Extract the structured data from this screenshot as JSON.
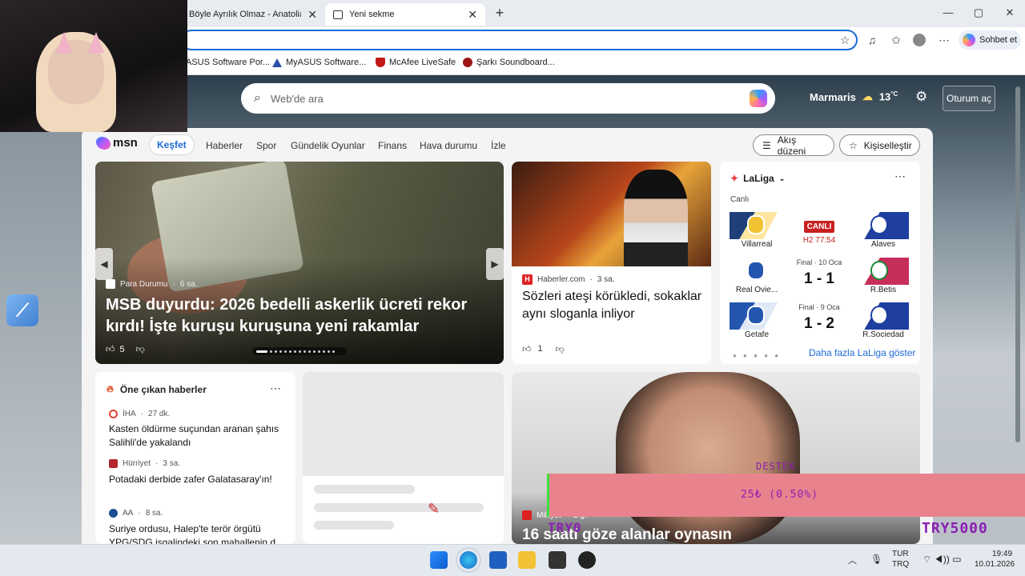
{
  "browser": {
    "tabs": [
      {
        "title": "Böyle Ayrılık Olmaz - Anatolian Psy",
        "active": false
      },
      {
        "title": "Yeni sekme",
        "active": true
      }
    ],
    "new_tab": "+",
    "window_controls": {
      "minimize": "—",
      "maximize": "▢",
      "close": "✕"
    },
    "address": "",
    "copilot_label": "Sohbet et",
    "bookmarks": [
      "ASUS Software Por...",
      "MyASUS Software...",
      "McAfee LiveSafe",
      "Şarkı Soundboard..."
    ]
  },
  "search": {
    "placeholder": "Web'de ara"
  },
  "weather": {
    "city": "Marmaris",
    "temp": "13",
    "unit": "°C"
  },
  "signin": "Oturum aç",
  "msn": {
    "logo": "msn",
    "nav": [
      "Keşfet",
      "Haberler",
      "Spor",
      "Gündelik Oyunlar",
      "Finans",
      "Hava durumu",
      "İzle"
    ],
    "feed_layout": "Akış düzeni",
    "personalize": "Kişiselleştir"
  },
  "hero": {
    "source": "Para Durumu",
    "age": "6 sa.",
    "title": "MSB duyurdu: 2026 bedelli askerlik ücreti rekor kırdı! İşte kuruşu kuruşuna yeni rakamlar",
    "likes": "5"
  },
  "card2": {
    "source": "Haberler.com",
    "age": "3 sa.",
    "title": "Sözleri ateşi körükledi, sokaklar aynı sloganla inliyor",
    "likes": "1"
  },
  "laliga": {
    "title": "LaLiga",
    "live_label": "Canlı",
    "matches": [
      {
        "home": "Villarreal",
        "away": "Alaves",
        "status": "CANLI",
        "time": "H2 77:54",
        "score": ""
      },
      {
        "home": "Real Ovie...",
        "away": "R.Betis",
        "status": "Final · 10 Oca",
        "time": "",
        "score": "1 - 1"
      },
      {
        "home": "Getafe",
        "away": "R.Sociedad",
        "status": "Final · 9 Oca",
        "time": "",
        "score": "1 - 2"
      }
    ],
    "more": "Daha fazla LaLiga göster"
  },
  "featured": {
    "title": "Öne çıkan haberler",
    "items": [
      {
        "source": "İHA",
        "age": "27 dk.",
        "title": "Kasten öldürme suçundan aranan şahıs Salihli'de yakalandı"
      },
      {
        "source": "Hürriyet",
        "age": "3 sa.",
        "title": "Potadaki derbide zafer Galatasaray'ın!"
      },
      {
        "source": "AA",
        "age": "8 sa.",
        "title": "Suriye ordusu, Halep'te terör örgütü YPG/SDG işgalindeki son mahallenin d..."
      }
    ]
  },
  "card4": {
    "source": "Milliyet",
    "age": "1 g.",
    "title": "16 saati göze alanlar oynasın"
  },
  "overlay": {
    "label": "DESTEK",
    "amount": "25₺ (0.50%)",
    "code_left": "TRY0",
    "code_right": "TRY5000"
  },
  "taskbar": {
    "lang": "TUR",
    "lang2": "TRQ",
    "time": "19:49",
    "date": "10.01.2026"
  },
  "colors": {
    "accent": "#1b6ad6",
    "live_red": "#c82121",
    "donation_bg": "#e8838e",
    "donation_text": "#8b1fb3"
  }
}
